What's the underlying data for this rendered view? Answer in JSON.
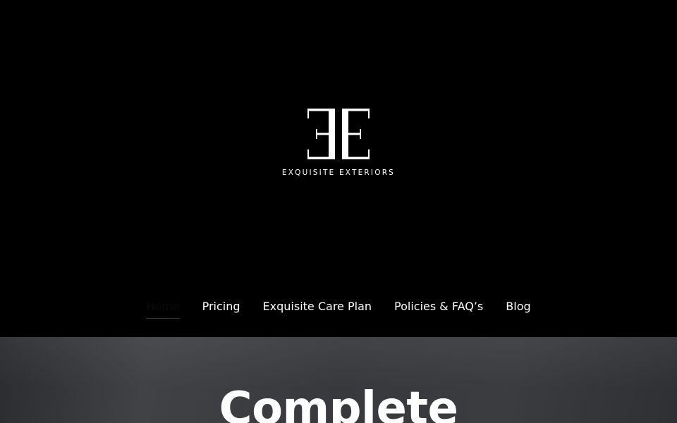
{
  "brand": {
    "logo_icon": "ee-monogram-logo",
    "name": "EXQUISITE EXTERIORS"
  },
  "nav": {
    "items": [
      {
        "label": "Home",
        "active": true
      },
      {
        "label": "Pricing",
        "active": false
      },
      {
        "label": "Exquisite Care Plan",
        "active": false
      },
      {
        "label": "Policies & FAQ’s",
        "active": false
      },
      {
        "label": "Blog",
        "active": false
      }
    ]
  },
  "hero": {
    "title": "Complete"
  },
  "colors": {
    "header_bg": "#000000",
    "hero_bg": "#3a3b3e",
    "text": "#ffffff"
  }
}
